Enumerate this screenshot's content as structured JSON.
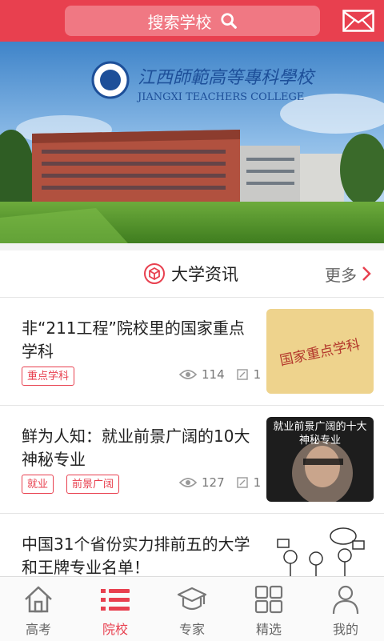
{
  "header": {
    "search_label": "搜索学校",
    "brand_color": "#e8404f"
  },
  "banner": {
    "school_name_cn": "江西師範高等專科學校",
    "school_name_en": "JIANGXI TEACHERS COLLEGE"
  },
  "section": {
    "title": "大学资讯",
    "more_label": "更多"
  },
  "news": [
    {
      "title": "非“211工程”院校里的国家重点学科",
      "tags": [
        "重点学科"
      ],
      "views": "114",
      "comments": "1",
      "thumb_text": "国家重点学科"
    },
    {
      "title": "鲜为人知：就业前景广阔的10大神秘专业",
      "tags": [
        "就业",
        "前景广阔"
      ],
      "views": "127",
      "comments": "1",
      "thumb_text": "就业前景广阔的十大神秘专业"
    },
    {
      "title": "中国31个省份实力排前五的大学和王牌专业名单！",
      "tags": [],
      "views": "",
      "comments": ""
    }
  ],
  "tabs": [
    {
      "label": "高考",
      "icon": "home-icon",
      "active": false
    },
    {
      "label": "院校",
      "icon": "list-icon",
      "active": true
    },
    {
      "label": "专家",
      "icon": "graduation-cap-icon",
      "active": false
    },
    {
      "label": "精选",
      "icon": "grid-icon",
      "active": false
    },
    {
      "label": "我的",
      "icon": "user-icon",
      "active": false
    }
  ]
}
